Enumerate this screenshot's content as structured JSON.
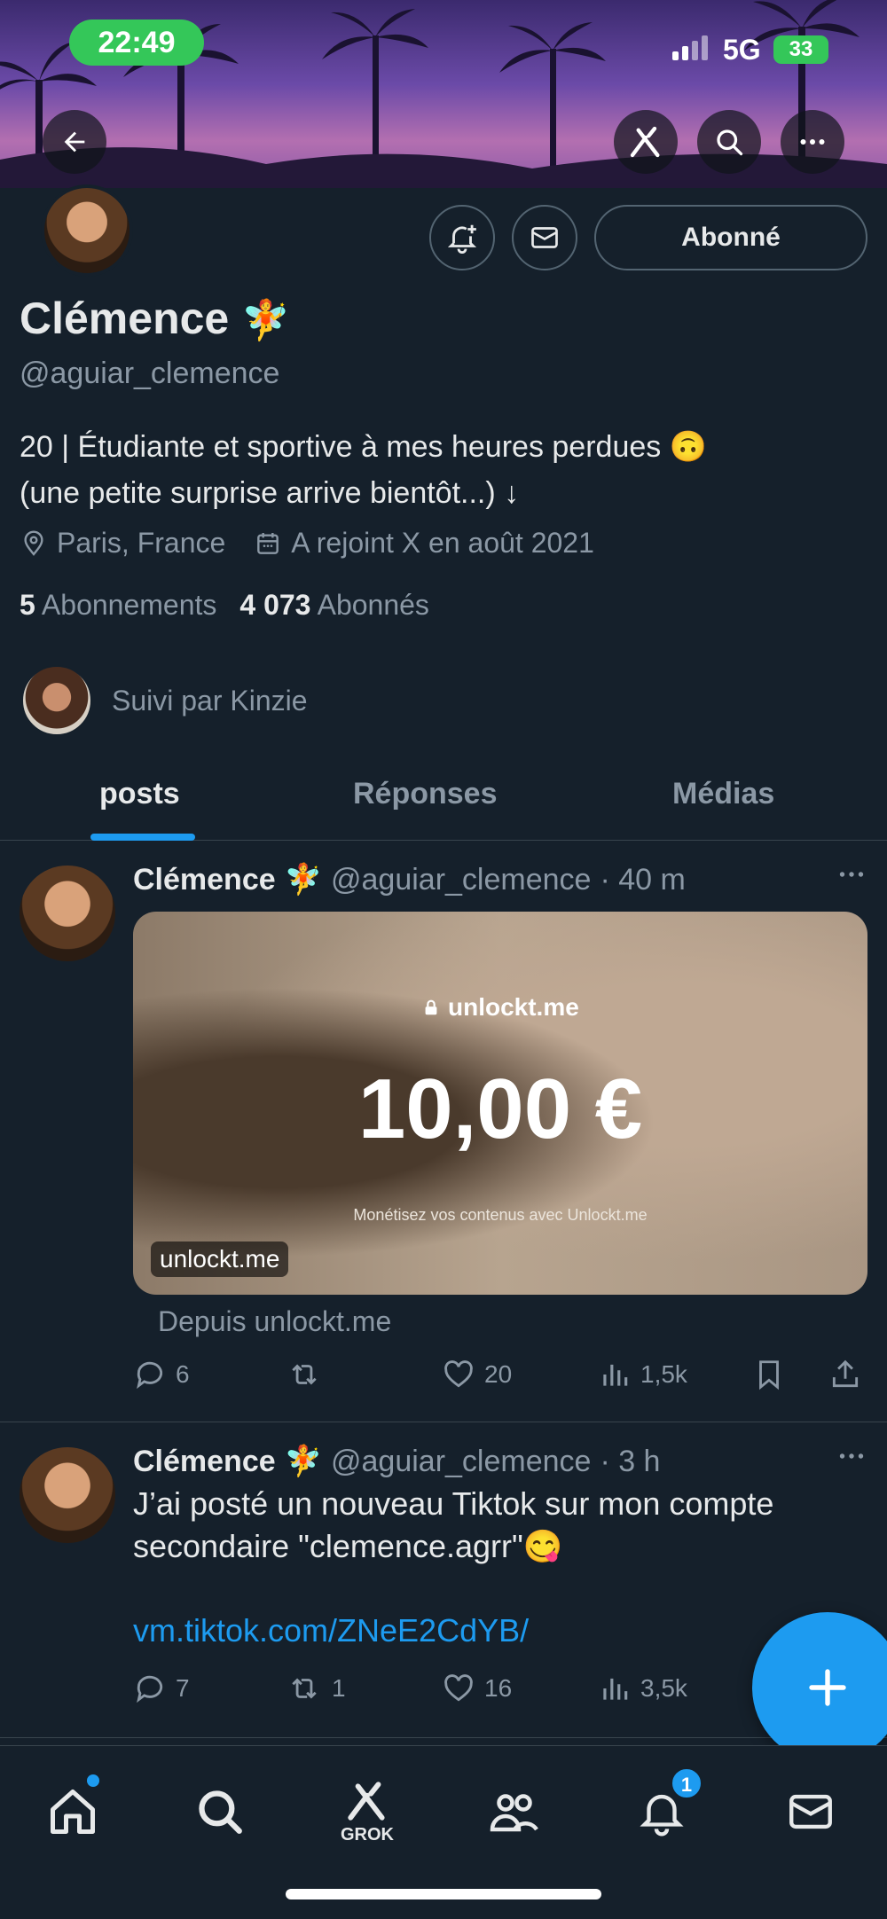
{
  "status_bar": {
    "time": "22:49",
    "network": "5G",
    "battery": "33"
  },
  "profile": {
    "name": "Clémence",
    "name_emoji": "🧚",
    "handle": "@aguiar_clemence",
    "bio_line1": "20 | Étudiante et sportive à mes heures perdues 🙃",
    "bio_line2": "(une petite surprise arrive bientôt...) ↓",
    "location": "Paris, France",
    "joined": "A rejoint X en août 2021",
    "following_count": "5",
    "following_label": "Abonnements",
    "followers_count": "4 073",
    "followers_label": "Abonnés",
    "followed_by": "Suivi par Kinzie",
    "follow_button": "Abonné"
  },
  "tabs": [
    {
      "label": "posts",
      "active": true
    },
    {
      "label": "Réponses",
      "active": false
    },
    {
      "label": "Médias",
      "active": false
    }
  ],
  "posts": [
    {
      "name": "Clémence",
      "emoji": "🧚",
      "handle": "@aguiar_clemence",
      "time": "· 40 m",
      "card": {
        "brand": "unlockt.me",
        "price": "10,00 €",
        "tagline": "Monétisez vos contenus avec Unlockt.me",
        "domain": "unlockt.me"
      },
      "source": "Depuis unlockt.me",
      "replies": "6",
      "reposts": "",
      "likes": "20",
      "views": "1,5k"
    },
    {
      "name": "Clémence",
      "emoji": "🧚",
      "handle": "@aguiar_clemence",
      "time": "· 3 h",
      "text_line1": "J’ai posté un nouveau Tiktok sur mon compte",
      "text_line2": "secondaire \"clemence.agrr\"😋",
      "link": "vm.tiktok.com/ZNeE2CdYB/",
      "replies": "7",
      "reposts": "1",
      "likes": "16",
      "views": "3,5k"
    }
  ],
  "bottom_nav": {
    "grok_label": "GROK",
    "notifications_badge": "1"
  },
  "colors": {
    "accent": "#1d9bf0",
    "background": "#15202b",
    "muted": "#8b98a5",
    "text": "#e7e9ea",
    "divider": "#38444d"
  }
}
